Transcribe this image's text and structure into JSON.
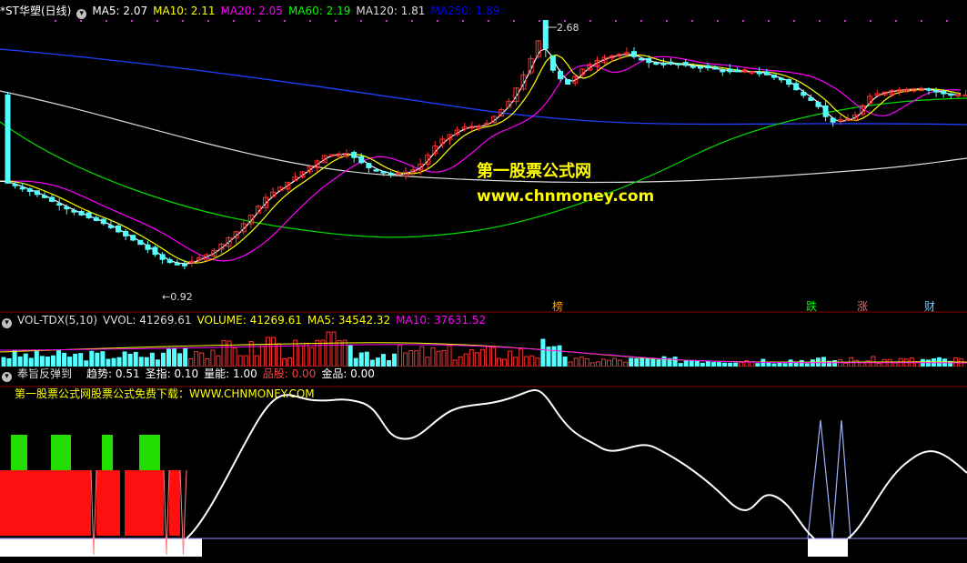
{
  "main_panel": {
    "title": "*ST华塑(日线)",
    "indicators": [
      {
        "label": "MA5: 2.07",
        "color": "#ffffff"
      },
      {
        "label": "MA10: 2.11",
        "color": "#ffff00"
      },
      {
        "label": "MA20: 2.05",
        "color": "#ff00ff"
      },
      {
        "label": "MA60: 2.19",
        "color": "#00ff00"
      },
      {
        "label": "MA120: 1.81",
        "color": "#dcdcdc"
      },
      {
        "label": "MA250: 1.89",
        "color": "#0000ff"
      }
    ],
    "high_label": "2.68",
    "low_label": "0.92",
    "watermark_title": "第一股票公式网",
    "watermark_url": "www.chnmoney.com",
    "event_labels": [
      {
        "text": "榜",
        "color": "#ff9900"
      },
      {
        "text": "跌",
        "color": "#00ff00"
      },
      {
        "text": "涨",
        "color": "#ff6060"
      },
      {
        "text": "财",
        "color": "#66ccff"
      }
    ]
  },
  "volume_panel": {
    "title": "VOL-TDX(5,10)",
    "indicators": [
      {
        "label": "VVOL: 41269.61",
        "color": "#dddddd"
      },
      {
        "label": "VOLUME: 41269.61",
        "color": "#ffff00"
      },
      {
        "label": "MA5: 34542.32",
        "color": "#ffff00"
      },
      {
        "label": "MA10: 37631.52",
        "color": "#ff00ff"
      }
    ]
  },
  "signal_panel": {
    "title": "奉旨反弹到",
    "indicators": [
      {
        "label": "趋势: 0.51",
        "color": "#ffffff"
      },
      {
        "label": "圣指: 0.10",
        "color": "#ffffff"
      },
      {
        "label": "量能: 1.00",
        "color": "#ffffff"
      },
      {
        "label": "品股: 0.00",
        "color": "#ff4040"
      },
      {
        "label": "金品: 0.00",
        "color": "#ffffff"
      }
    ],
    "download_note": "第一股票公式网股票公式免费下载：WWW.CHNMONEY.COM"
  },
  "colors": {
    "up": "#ff3030",
    "down": "#54ffff",
    "grid": "#8b0000"
  }
}
